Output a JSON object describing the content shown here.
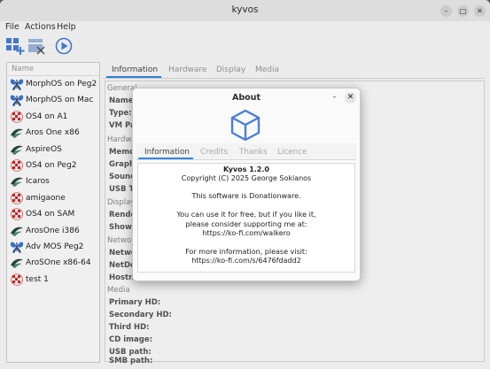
{
  "window": {
    "title": "kyvos"
  },
  "menu": [
    "File",
    "Actions",
    "Help"
  ],
  "toolbar": {
    "icons": [
      "add-vm-icon",
      "remove-vm-icon",
      "run-icon"
    ]
  },
  "vmlist": {
    "header": "Name",
    "items": [
      {
        "label": "MorphOS on Peg2",
        "icon": "butterfly"
      },
      {
        "label": "MorphOS on Mac",
        "icon": "butterfly"
      },
      {
        "label": "OS4 on A1",
        "icon": "boing-ball"
      },
      {
        "label": "Aros One x86",
        "icon": "aros"
      },
      {
        "label": "AspireOS",
        "icon": "aros"
      },
      {
        "label": "OS4 on Peg2",
        "icon": "boing-ball"
      },
      {
        "label": "Icaros",
        "icon": "aros"
      },
      {
        "label": "amigaone",
        "icon": "boing-ball"
      },
      {
        "label": "OS4 on SAM",
        "icon": "boing-ball"
      },
      {
        "label": "ArosOne i386",
        "icon": "aros"
      },
      {
        "label": "Adv MOS Peg2",
        "icon": "butterfly"
      },
      {
        "label": "AroSOne x86-64",
        "icon": "aros"
      },
      {
        "label": "test 1",
        "icon": "boing-ball"
      }
    ]
  },
  "main": {
    "tabs": [
      "Information",
      "Hardware",
      "Display",
      "Media"
    ],
    "groups": {
      "general": {
        "title": "General",
        "fields": [
          "Name:",
          "Type:",
          "VM Pa"
        ]
      },
      "hardware": {
        "title": "Hardwa",
        "fields": [
          "Memo",
          "Graphi",
          "Sound",
          "USB Ta"
        ]
      },
      "display": {
        "title": "Display",
        "fields": [
          "Rende",
          "Show"
        ]
      },
      "network": {
        "title": "Netwo",
        "fields": [
          "Netwo",
          "NetDe",
          "Hostn"
        ]
      },
      "media": {
        "title": "Media",
        "fields": [
          "Primary HD:",
          "Secondary HD:",
          "Third HD:",
          "CD image:",
          "USB path:",
          "SMB path:"
        ]
      }
    }
  },
  "about": {
    "title": "About",
    "tabs": [
      "Information",
      "Credits",
      "Thanks",
      "Licence"
    ],
    "lines": [
      "Kyvos 1.2.0",
      "Copyright (C) 2025 George Sokianos",
      "This software is Donationware.",
      "You can use it for free, but if you like it,",
      "please consider supporting me at:",
      "https://ko-fi.com/walkero",
      "For more information, please visit:",
      "https://ko-fi.com/s/6476fdadd2"
    ]
  },
  "colors": {
    "accent": "#3584e4",
    "icon_blue": "#4a7fd6"
  }
}
